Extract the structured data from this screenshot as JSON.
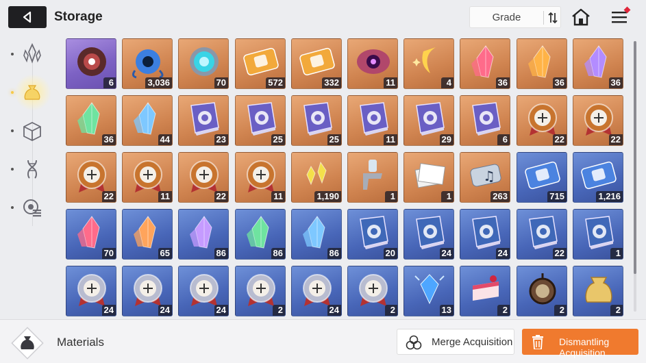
{
  "header": {
    "title": "Storage",
    "sort_label": "Grade"
  },
  "sidebar": {
    "items": [
      {
        "icon": "crystal-icon",
        "active": false
      },
      {
        "icon": "pouch-icon",
        "active": true
      },
      {
        "icon": "cube-icon",
        "active": false
      },
      {
        "icon": "dna-icon",
        "active": false
      },
      {
        "icon": "badge-list-icon",
        "active": false
      }
    ]
  },
  "colors": {
    "purple_grade": "#7d62c4",
    "orange_grade": "#d08450",
    "blue_grade": "#4866b8",
    "accent": "#f07a2e"
  },
  "items": [
    {
      "name": "mask-core",
      "grade": "purple",
      "qty": "6"
    },
    {
      "name": "tentacle-eye",
      "grade": "orange",
      "qty": "3,036"
    },
    {
      "name": "orb-device",
      "grade": "orange",
      "qty": "70"
    },
    {
      "name": "ticket-portrait",
      "grade": "orange",
      "qty": "572"
    },
    {
      "name": "ticket-disc",
      "grade": "orange",
      "qty": "332"
    },
    {
      "name": "eye-flesh",
      "grade": "orange",
      "qty": "11"
    },
    {
      "name": "moon-feather",
      "grade": "orange",
      "qty": "4"
    },
    {
      "name": "crystal-red",
      "grade": "orange",
      "qty": "36"
    },
    {
      "name": "crystal-amber",
      "grade": "orange",
      "qty": "36"
    },
    {
      "name": "crystal-violet",
      "grade": "orange",
      "qty": "36"
    },
    {
      "name": "crystal-green",
      "grade": "orange",
      "qty": "36"
    },
    {
      "name": "crystal-blue",
      "grade": "orange",
      "qty": "44"
    },
    {
      "name": "book-swords",
      "grade": "orange",
      "qty": "23"
    },
    {
      "name": "book-shield",
      "grade": "orange",
      "qty": "25"
    },
    {
      "name": "book-eye",
      "grade": "orange",
      "qty": "25"
    },
    {
      "name": "book-blades",
      "grade": "orange",
      "qty": "11"
    },
    {
      "name": "book-cross",
      "grade": "orange",
      "qty": "29"
    },
    {
      "name": "book-rune",
      "grade": "orange",
      "qty": "6"
    },
    {
      "name": "medal-sword",
      "grade": "orange",
      "qty": "22"
    },
    {
      "name": "medal-shield",
      "grade": "orange",
      "qty": "22"
    },
    {
      "name": "medal-eye",
      "grade": "orange",
      "qty": "22"
    },
    {
      "name": "medal-blades",
      "grade": "orange",
      "qty": "11"
    },
    {
      "name": "medal-cross",
      "grade": "orange",
      "qty": "22"
    },
    {
      "name": "medal-rune",
      "grade": "orange",
      "qty": "11"
    },
    {
      "name": "yellow-shards",
      "grade": "orange",
      "qty": "1,190"
    },
    {
      "name": "spray-gun",
      "grade": "orange",
      "qty": "1"
    },
    {
      "name": "paper-stack",
      "grade": "orange",
      "qty": "1"
    },
    {
      "name": "music-scroll",
      "grade": "orange",
      "qty": "263"
    },
    {
      "name": "ticket-blue-portrait",
      "grade": "blue",
      "qty": "715"
    },
    {
      "name": "ticket-blue-star",
      "grade": "blue",
      "qty": "1,216"
    },
    {
      "name": "shard-red",
      "grade": "blue",
      "qty": "70"
    },
    {
      "name": "shard-orange",
      "grade": "blue",
      "qty": "65"
    },
    {
      "name": "shard-purple",
      "grade": "blue",
      "qty": "86"
    },
    {
      "name": "shard-green",
      "grade": "blue",
      "qty": "86"
    },
    {
      "name": "shard-blue",
      "grade": "blue",
      "qty": "86"
    },
    {
      "name": "tome-swords",
      "grade": "blue",
      "qty": "20"
    },
    {
      "name": "tome-shield",
      "grade": "blue",
      "qty": "24"
    },
    {
      "name": "tome-eye",
      "grade": "blue",
      "qty": "24"
    },
    {
      "name": "tome-cross",
      "grade": "blue",
      "qty": "22"
    },
    {
      "name": "tome-rune",
      "grade": "blue",
      "qty": "1"
    },
    {
      "name": "silver-medal-sword",
      "grade": "blue",
      "qty": "24"
    },
    {
      "name": "silver-medal-shield",
      "grade": "blue",
      "qty": "24"
    },
    {
      "name": "silver-medal-eye",
      "grade": "blue",
      "qty": "24"
    },
    {
      "name": "silver-medal-blades",
      "grade": "blue",
      "qty": "2"
    },
    {
      "name": "silver-medal-cross",
      "grade": "blue",
      "qty": "24"
    },
    {
      "name": "silver-medal-rune",
      "grade": "blue",
      "qty": "2"
    },
    {
      "name": "blue-gem",
      "grade": "blue",
      "qty": "13"
    },
    {
      "name": "cake-slice",
      "grade": "blue",
      "qty": "2"
    },
    {
      "name": "pocket-watch",
      "grade": "blue",
      "qty": "2"
    },
    {
      "name": "gold-pouch",
      "grade": "blue",
      "qty": "2"
    }
  ],
  "footer": {
    "category": "Materials",
    "merge_label": "Merge Acquisition",
    "dismantle_label": "Dismantling Acquisition"
  }
}
